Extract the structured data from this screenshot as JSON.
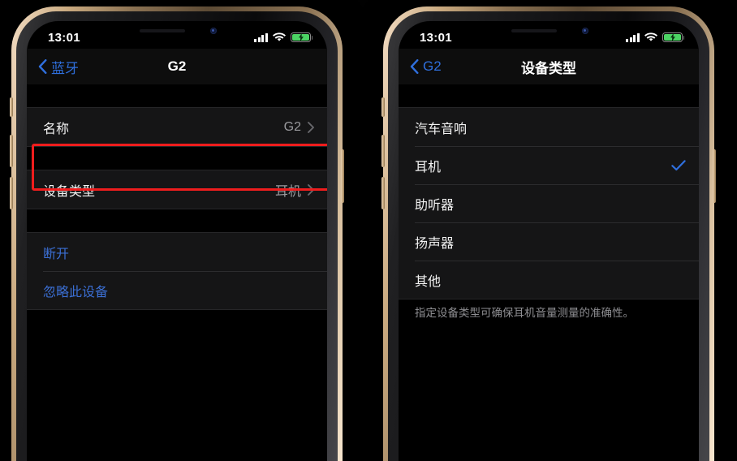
{
  "colors": {
    "accent_blue": "#2f6fdd",
    "highlight_red": "#ef1d1d",
    "battery_green": "#4cd364",
    "row_bg": "#151516",
    "screen_bg": "#000000",
    "secondary_text": "#9a9a9e"
  },
  "phones": [
    {
      "id": "left",
      "status_bar": {
        "time": "13:01",
        "cellular_icon": "signal-bars-icon",
        "wifi_icon": "wifi-icon",
        "battery_icon": "battery-charging-icon",
        "battery_state": "charging"
      },
      "nav": {
        "back_label": "蓝牙",
        "back_icon": "chevron-left-icon",
        "title": "G2"
      },
      "sections": [
        {
          "rows": [
            {
              "label": "名称",
              "value": "G2",
              "accessory": "chevron-right-icon",
              "style": "normal"
            }
          ]
        },
        {
          "highlighted": true,
          "rows": [
            {
              "label": "设备类型",
              "value": "耳机",
              "accessory": "chevron-right-icon",
              "style": "normal"
            }
          ]
        },
        {
          "rows": [
            {
              "label": "断开",
              "value": "",
              "accessory": "none",
              "style": "action"
            },
            {
              "label": "忽略此设备",
              "value": "",
              "accessory": "none",
              "style": "action"
            }
          ]
        }
      ],
      "footnote": ""
    },
    {
      "id": "right",
      "status_bar": {
        "time": "13:01",
        "cellular_icon": "signal-bars-icon",
        "wifi_icon": "wifi-icon",
        "battery_icon": "battery-charging-icon",
        "battery_state": "charging"
      },
      "nav": {
        "back_label": "G2",
        "back_icon": "chevron-left-icon",
        "title": "设备类型"
      },
      "sections": [
        {
          "highlighted": false,
          "rows": [
            {
              "label": "汽车音响",
              "value": "",
              "accessory": "none",
              "style": "normal"
            },
            {
              "label": "耳机",
              "value": "",
              "accessory": "checkmark-icon",
              "style": "normal",
              "selected": true
            },
            {
              "label": "助听器",
              "value": "",
              "accessory": "none",
              "style": "normal"
            },
            {
              "label": "扬声器",
              "value": "",
              "accessory": "none",
              "style": "normal"
            },
            {
              "label": "其他",
              "value": "",
              "accessory": "none",
              "style": "normal"
            }
          ]
        }
      ],
      "footnote": "指定设备类型可确保耳机音量测量的准确性。"
    }
  ]
}
